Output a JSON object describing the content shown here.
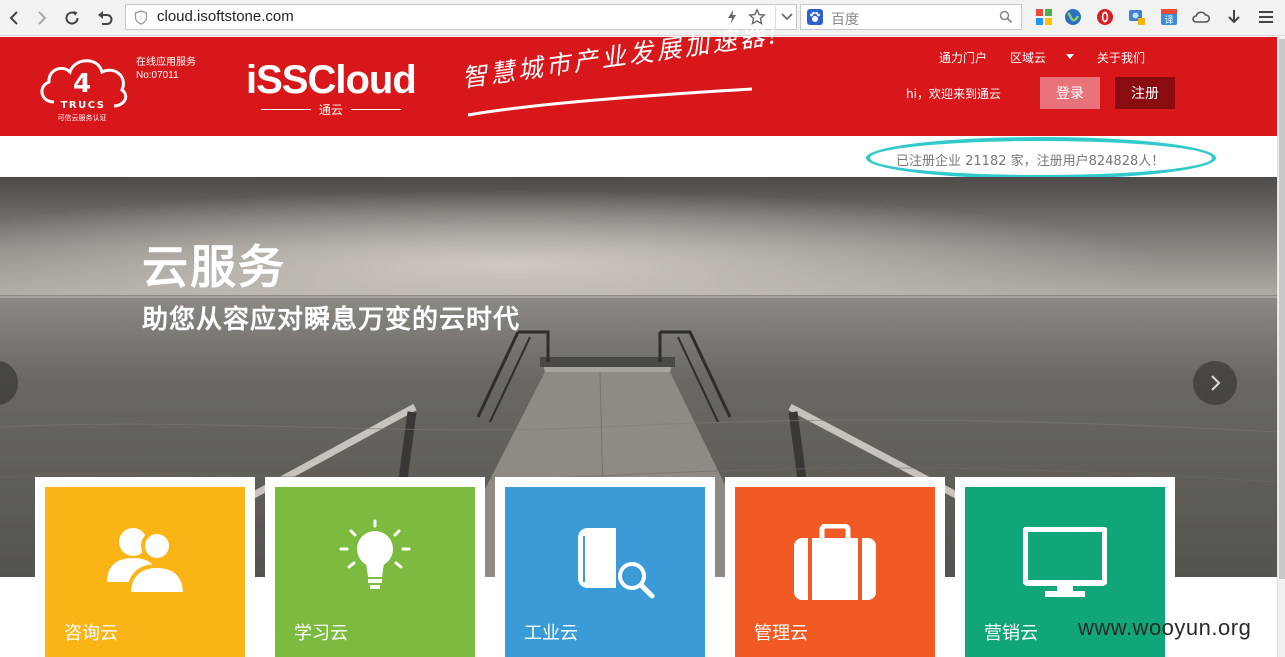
{
  "browser": {
    "url": "cloud.isoftstone.com",
    "search_placeholder": "百度"
  },
  "header": {
    "service_line1": "在线应用服务",
    "service_line2": "No:07011",
    "trucs_text": "TRUCS",
    "trucs_caption": "可信云服务认证",
    "brand_name": "iSSCloud",
    "brand_sub": "通云",
    "slogan": "智慧城市产业发展加速器!",
    "nav": {
      "portal": "通力门户",
      "region": "区域云",
      "about": "关于我们"
    },
    "greeting": "hi，欢迎来到通云",
    "login": "登录",
    "register": "注册",
    "colors": {
      "brand_red": "#d8171b",
      "register_bg": "#8a0b10",
      "login_bg": "#e8737a"
    }
  },
  "stats_text": "已注册企业 21182 家，注册用户824828人！",
  "hero": {
    "title": "云服务",
    "subtitle": "助您从容应对瞬息万变的云时代"
  },
  "tiles": [
    {
      "label": "咨询云",
      "icon": "users-icon",
      "color": "#fbb415"
    },
    {
      "label": "学习云",
      "icon": "lightbulb-icon",
      "color": "#7cbb3f"
    },
    {
      "label": "工业云",
      "icon": "book-search-icon",
      "color": "#3a9bd7"
    },
    {
      "label": "管理云",
      "icon": "briefcase-icon",
      "color": "#f15a24"
    },
    {
      "label": "营销云",
      "icon": "monitor-icon",
      "color": "#11a67a"
    }
  ],
  "watermark": "www.wooyun.org"
}
